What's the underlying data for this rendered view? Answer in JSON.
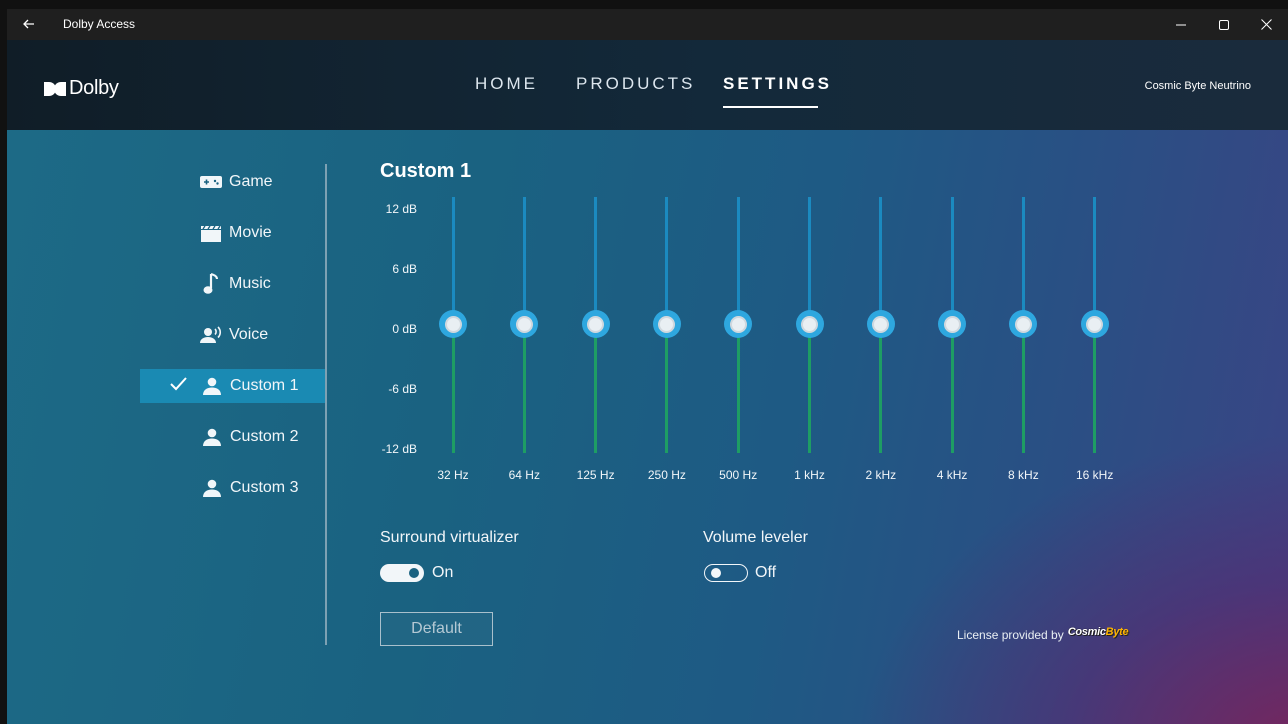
{
  "window": {
    "title": "Dolby Access"
  },
  "header": {
    "logo_text": "Dolby",
    "nav": [
      "HOME",
      "PRODUCTS",
      "SETTINGS"
    ],
    "active_nav": "SETTINGS",
    "device": "Cosmic Byte Neutrino"
  },
  "sidebar": {
    "items": [
      {
        "label": "Game",
        "icon": "gamepad-icon"
      },
      {
        "label": "Movie",
        "icon": "clapperboard-icon"
      },
      {
        "label": "Music",
        "icon": "music-note-icon"
      },
      {
        "label": "Voice",
        "icon": "voice-icon"
      },
      {
        "label": "Custom 1",
        "icon": "person-icon",
        "selected": true
      },
      {
        "label": "Custom 2",
        "icon": "person-icon"
      },
      {
        "label": "Custom 3",
        "icon": "person-icon"
      }
    ]
  },
  "equalizer": {
    "title": "Custom 1",
    "db_labels": [
      "12 dB",
      "6 dB",
      "0 dB",
      "-6 dB",
      "-12 dB"
    ],
    "bands": [
      "32 Hz",
      "64 Hz",
      "125 Hz",
      "250 Hz",
      "500 Hz",
      "1 kHz",
      "2 kHz",
      "4 kHz",
      "8 kHz",
      "16 kHz"
    ],
    "gains_db": [
      0,
      0,
      0,
      0,
      0,
      0,
      0,
      0,
      0,
      0
    ],
    "range_db": [
      -12,
      12
    ]
  },
  "options": {
    "surround": {
      "label": "Surround virtualizer",
      "state": "On"
    },
    "leveler": {
      "label": "Volume leveler",
      "state": "Off"
    }
  },
  "default_button": "Default",
  "license": {
    "text": "License provided by",
    "logo_text_a": "Cosmic",
    "logo_text_b": "Byte"
  },
  "colors": {
    "accent": "#1a8ab3",
    "track_top": "#1b8ac0",
    "track_bottom": "#1e9d64",
    "knob": "#2ea7df"
  }
}
